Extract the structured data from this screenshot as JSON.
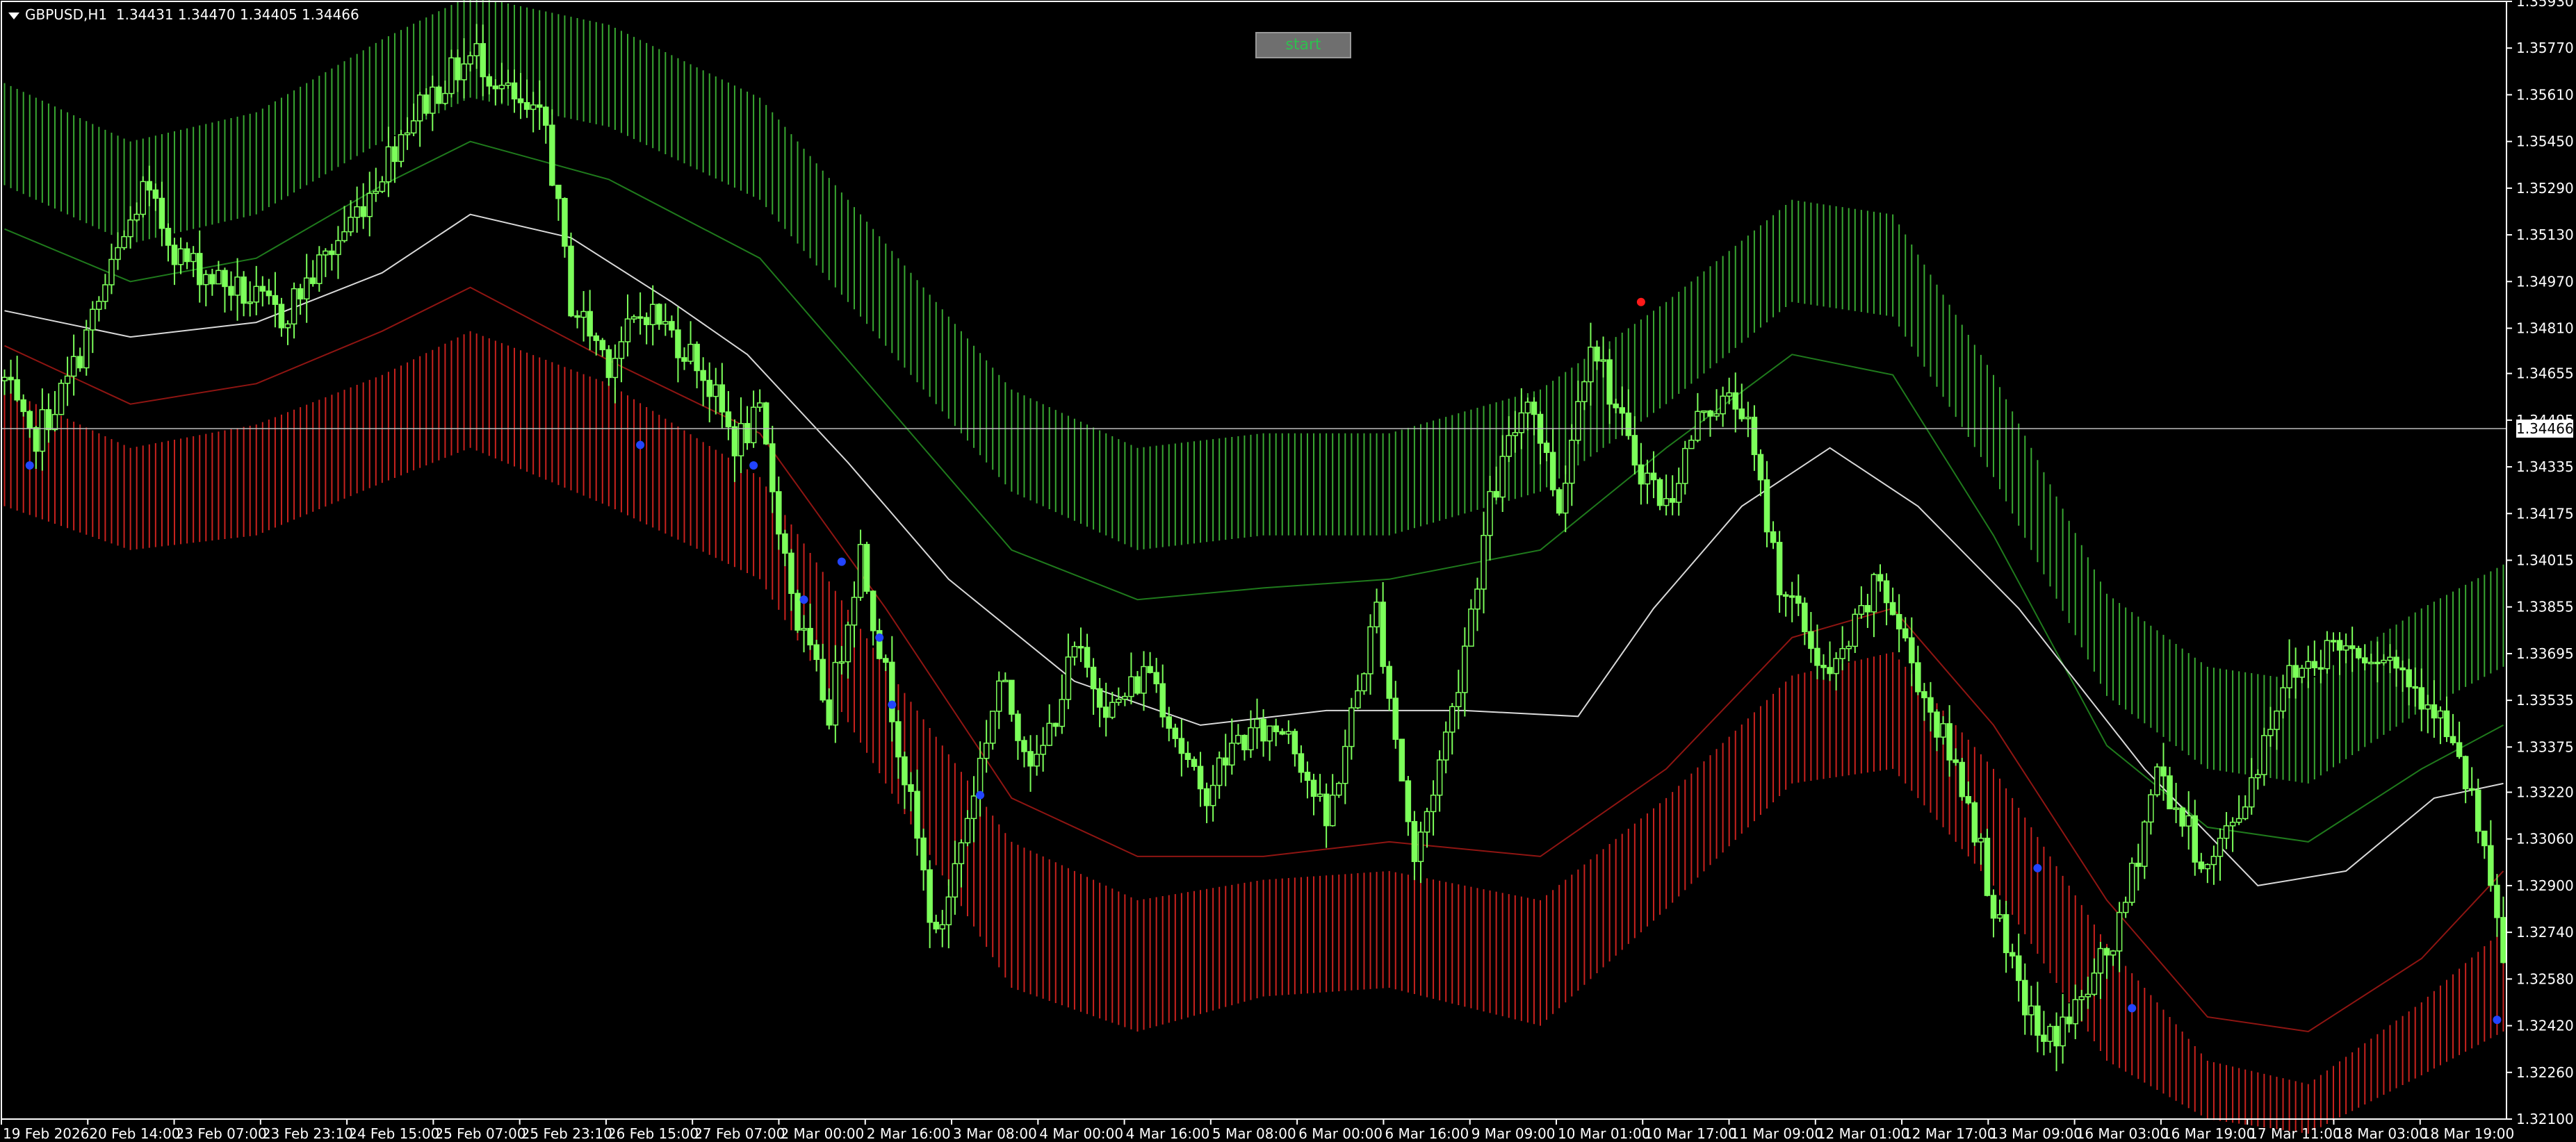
{
  "window": {
    "symbol_timeframe": "GBPUSD,H1",
    "quote": "1.34431 1.34470 1.34405 1.34466"
  },
  "button": {
    "start_label": "start"
  },
  "colors": {
    "background": "#000000",
    "candle": "#7cff5a",
    "upper_band": "#39a832",
    "lower_band": "#c8221e",
    "mid_line": "#d9d9d9",
    "dot_blue": "#2244ff",
    "dot_red": "#ff1a1a",
    "axis": "#ffffff"
  },
  "chart_data": {
    "type": "candlestick",
    "instrument": "GBPUSD",
    "timeframe": "H1",
    "current_price_label": "1.34466",
    "ylim": [
      1.321,
      1.3593
    ],
    "y_ticks": [
      "1.35930",
      "1.35770",
      "1.35610",
      "1.35450",
      "1.35290",
      "1.35130",
      "1.34970",
      "1.34810",
      "1.34655",
      "1.34495",
      "1.34335",
      "1.34175",
      "1.34015",
      "1.33855",
      "1.33695",
      "1.33535",
      "1.33375",
      "1.33220",
      "1.33060",
      "1.32900",
      "1.32740",
      "1.32580",
      "1.32420",
      "1.32260",
      "1.32100"
    ],
    "x_ticks": [
      "19 Feb 2026",
      "20 Feb 14:00",
      "23 Feb 07:00",
      "23 Feb 23:10",
      "24 Feb 15:00",
      "25 Feb 07:00",
      "25 Feb 23:10",
      "26 Feb 15:00",
      "27 Feb 07:00",
      "2 Mar 00:00",
      "2 Mar 16:00",
      "3 Mar 08:00",
      "4 Mar 00:00",
      "4 Mar 16:00",
      "5 Mar 08:00",
      "6 Mar 00:00",
      "6 Mar 16:00",
      "9 Mar 09:00",
      "10 Mar 01:00",
      "10 Mar 17:00",
      "11 Mar 09:00",
      "12 Mar 01:00",
      "12 Mar 17:00",
      "13 Mar 09:00",
      "16 Mar 03:00",
      "16 Mar 19:00",
      "17 Mar 11:00",
      "18 Mar 03:00",
      "18 Mar 19:00"
    ],
    "price_path": [
      [
        0,
        1.3463
      ],
      [
        4,
        1.3441
      ],
      [
        10,
        1.3462
      ],
      [
        16,
        1.3495
      ],
      [
        22,
        1.3528
      ],
      [
        28,
        1.3505
      ],
      [
        36,
        1.3495
      ],
      [
        44,
        1.3485
      ],
      [
        52,
        1.3508
      ],
      [
        58,
        1.3528
      ],
      [
        64,
        1.3552
      ],
      [
        70,
        1.3566
      ],
      [
        75,
        1.3575
      ],
      [
        82,
        1.3555
      ],
      [
        86,
        1.355
      ],
      [
        90,
        1.349
      ],
      [
        96,
        1.347
      ],
      [
        102,
        1.3488
      ],
      [
        110,
        1.347
      ],
      [
        116,
        1.3442
      ],
      [
        120,
        1.345
      ],
      [
        126,
        1.338
      ],
      [
        131,
        1.335
      ],
      [
        136,
        1.3405
      ],
      [
        142,
        1.334
      ],
      [
        148,
        1.327
      ],
      [
        152,
        1.3305
      ],
      [
        158,
        1.336
      ],
      [
        164,
        1.333
      ],
      [
        170,
        1.337
      ],
      [
        176,
        1.335
      ],
      [
        182,
        1.3365
      ],
      [
        190,
        1.332
      ],
      [
        196,
        1.334
      ],
      [
        204,
        1.3345
      ],
      [
        210,
        1.331
      ],
      [
        218,
        1.3385
      ],
      [
        224,
        1.3298
      ],
      [
        230,
        1.335
      ],
      [
        236,
        1.342
      ],
      [
        242,
        1.346
      ],
      [
        247,
        1.342
      ],
      [
        252,
        1.348
      ],
      [
        258,
        1.344
      ],
      [
        264,
        1.342
      ],
      [
        270,
        1.3455
      ],
      [
        276,
        1.3455
      ],
      [
        282,
        1.3395
      ],
      [
        290,
        1.336
      ],
      [
        298,
        1.3395
      ],
      [
        306,
        1.335
      ],
      [
        312,
        1.332
      ],
      [
        318,
        1.3265
      ],
      [
        324,
        1.3235
      ],
      [
        330,
        1.325
      ],
      [
        336,
        1.3275
      ],
      [
        342,
        1.333
      ],
      [
        350,
        1.3295
      ],
      [
        356,
        1.332
      ],
      [
        362,
        1.336
      ],
      [
        370,
        1.3373
      ],
      [
        378,
        1.337
      ],
      [
        386,
        1.3352
      ],
      [
        392,
        1.332
      ],
      [
        397,
        1.3265
      ]
    ],
    "mid_line": [
      [
        0,
        1.3487
      ],
      [
        20,
        1.3478
      ],
      [
        40,
        1.3483
      ],
      [
        60,
        1.35
      ],
      [
        74,
        1.352
      ],
      [
        90,
        1.3512
      ],
      [
        106,
        1.349
      ],
      [
        118,
        1.3472
      ],
      [
        134,
        1.3435
      ],
      [
        150,
        1.3395
      ],
      [
        170,
        1.336
      ],
      [
        190,
        1.3345
      ],
      [
        210,
        1.335
      ],
      [
        232,
        1.335
      ],
      [
        250,
        1.3348
      ],
      [
        262,
        1.3385
      ],
      [
        276,
        1.342
      ],
      [
        290,
        1.344
      ],
      [
        304,
        1.342
      ],
      [
        320,
        1.3385
      ],
      [
        340,
        1.333
      ],
      [
        358,
        1.329
      ],
      [
        372,
        1.3295
      ],
      [
        386,
        1.332
      ],
      [
        397,
        1.3325
      ]
    ],
    "bands": {
      "upper_outer": [
        [
          0,
          1.3565
        ],
        [
          20,
          1.3545
        ],
        [
          40,
          1.3555
        ],
        [
          60,
          1.358
        ],
        [
          74,
          1.3595
        ],
        [
          96,
          1.3585
        ],
        [
          120,
          1.356
        ],
        [
          140,
          1.351
        ],
        [
          160,
          1.346
        ],
        [
          180,
          1.344
        ],
        [
          200,
          1.3445
        ],
        [
          220,
          1.3445
        ],
        [
          244,
          1.346
        ],
        [
          264,
          1.349
        ],
        [
          284,
          1.3525
        ],
        [
          300,
          1.352
        ],
        [
          316,
          1.3465
        ],
        [
          334,
          1.339
        ],
        [
          350,
          1.3365
        ],
        [
          366,
          1.336
        ],
        [
          384,
          1.3385
        ],
        [
          397,
          1.34
        ]
      ],
      "upper_inner": [
        [
          0,
          1.353
        ],
        [
          20,
          1.351
        ],
        [
          40,
          1.352
        ],
        [
          60,
          1.3545
        ],
        [
          74,
          1.356
        ],
        [
          96,
          1.355
        ],
        [
          120,
          1.3525
        ],
        [
          140,
          1.3475
        ],
        [
          160,
          1.3425
        ],
        [
          180,
          1.3405
        ],
        [
          200,
          1.341
        ],
        [
          220,
          1.341
        ],
        [
          244,
          1.3425
        ],
        [
          264,
          1.3455
        ],
        [
          284,
          1.349
        ],
        [
          300,
          1.3485
        ],
        [
          316,
          1.343
        ],
        [
          334,
          1.3355
        ],
        [
          350,
          1.333
        ],
        [
          366,
          1.3325
        ],
        [
          384,
          1.335
        ],
        [
          397,
          1.3365
        ]
      ],
      "upper_mid": [
        [
          0,
          1.3515
        ],
        [
          20,
          1.3497
        ],
        [
          40,
          1.3505
        ],
        [
          60,
          1.353
        ],
        [
          74,
          1.3545
        ],
        [
          96,
          1.3532
        ],
        [
          120,
          1.3505
        ],
        [
          140,
          1.3455
        ],
        [
          160,
          1.3405
        ],
        [
          180,
          1.3388
        ],
        [
          200,
          1.3392
        ],
        [
          220,
          1.3395
        ],
        [
          244,
          1.3405
        ],
        [
          264,
          1.344
        ],
        [
          284,
          1.3472
        ],
        [
          300,
          1.3465
        ],
        [
          316,
          1.341
        ],
        [
          334,
          1.3338
        ],
        [
          350,
          1.331
        ],
        [
          366,
          1.3305
        ],
        [
          384,
          1.333
        ],
        [
          397,
          1.3345
        ]
      ],
      "lower_mid": [
        [
          0,
          1.3475
        ],
        [
          20,
          1.3455
        ],
        [
          40,
          1.3462
        ],
        [
          60,
          1.348
        ],
        [
          74,
          1.3495
        ],
        [
          96,
          1.347
        ],
        [
          120,
          1.3445
        ],
        [
          140,
          1.3385
        ],
        [
          160,
          1.332
        ],
        [
          180,
          1.33
        ],
        [
          200,
          1.33
        ],
        [
          220,
          1.3305
        ],
        [
          244,
          1.33
        ],
        [
          264,
          1.333
        ],
        [
          284,
          1.3375
        ],
        [
          300,
          1.3385
        ],
        [
          316,
          1.3345
        ],
        [
          334,
          1.3285
        ],
        [
          350,
          1.3245
        ],
        [
          366,
          1.324
        ],
        [
          384,
          1.3265
        ],
        [
          397,
          1.3295
        ]
      ],
      "lower_inner": [
        [
          0,
          1.346
        ],
        [
          20,
          1.344
        ],
        [
          40,
          1.3448
        ],
        [
          60,
          1.3465
        ],
        [
          74,
          1.348
        ],
        [
          96,
          1.3462
        ],
        [
          120,
          1.343
        ],
        [
          140,
          1.3365
        ],
        [
          160,
          1.3305
        ],
        [
          180,
          1.3285
        ],
        [
          200,
          1.3292
        ],
        [
          220,
          1.3295
        ],
        [
          244,
          1.3285
        ],
        [
          264,
          1.332
        ],
        [
          284,
          1.3362
        ],
        [
          300,
          1.337
        ],
        [
          316,
          1.333
        ],
        [
          334,
          1.327
        ],
        [
          350,
          1.323
        ],
        [
          366,
          1.3222
        ],
        [
          384,
          1.325
        ],
        [
          397,
          1.3275
        ]
      ],
      "lower_outer": [
        [
          0,
          1.342
        ],
        [
          20,
          1.3405
        ],
        [
          40,
          1.341
        ],
        [
          60,
          1.3428
        ],
        [
          74,
          1.344
        ],
        [
          96,
          1.342
        ],
        [
          120,
          1.3395
        ],
        [
          140,
          1.3325
        ],
        [
          160,
          1.3255
        ],
        [
          180,
          1.324
        ],
        [
          200,
          1.3252
        ],
        [
          220,
          1.3255
        ],
        [
          244,
          1.3242
        ],
        [
          264,
          1.3282
        ],
        [
          284,
          1.3325
        ],
        [
          300,
          1.333
        ],
        [
          316,
          1.329
        ],
        [
          334,
          1.323
        ],
        [
          350,
          1.321
        ],
        [
          366,
          1.3205
        ],
        [
          384,
          1.3225
        ],
        [
          397,
          1.324
        ]
      ]
    },
    "markers": [
      {
        "x": 4,
        "y": 1.3434,
        "color": "blue"
      },
      {
        "x": 101,
        "y": 1.3441,
        "color": "blue"
      },
      {
        "x": 119,
        "y": 1.3434,
        "color": "blue"
      },
      {
        "x": 127,
        "y": 1.3388,
        "color": "blue"
      },
      {
        "x": 133,
        "y": 1.3401,
        "color": "blue"
      },
      {
        "x": 139,
        "y": 1.3375,
        "color": "blue"
      },
      {
        "x": 141,
        "y": 1.3352,
        "color": "blue"
      },
      {
        "x": 155,
        "y": 1.3321,
        "color": "blue"
      },
      {
        "x": 260,
        "y": 1.349,
        "color": "red"
      },
      {
        "x": 323,
        "y": 1.3296,
        "color": "blue"
      },
      {
        "x": 338,
        "y": 1.3248,
        "color": "blue"
      },
      {
        "x": 396,
        "y": 1.3244,
        "color": "blue"
      }
    ]
  }
}
